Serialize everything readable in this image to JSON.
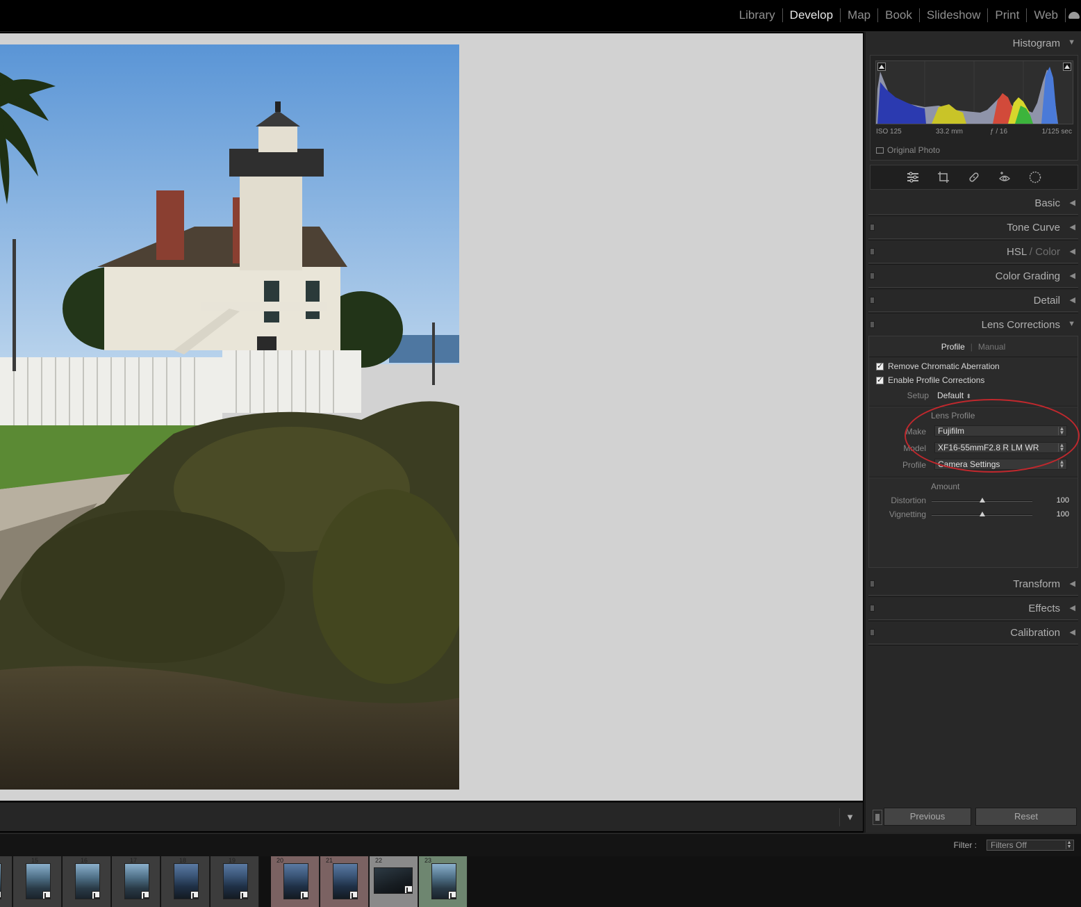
{
  "modules": [
    {
      "label": "Library",
      "active": false
    },
    {
      "label": "Develop",
      "active": true
    },
    {
      "label": "Map",
      "active": false
    },
    {
      "label": "Book",
      "active": false
    },
    {
      "label": "Slideshow",
      "active": false
    },
    {
      "label": "Print",
      "active": false
    },
    {
      "label": "Web",
      "active": false
    }
  ],
  "histogram": {
    "title": "Histogram",
    "iso": "ISO 125",
    "focal": "33.2 mm",
    "aperture": "ƒ / 16",
    "shutter": "1/125 sec",
    "original_photo": "Original Photo"
  },
  "tools": [
    "sliders-icon",
    "crop-icon",
    "healing-icon",
    "redeye-icon",
    "mask-icon"
  ],
  "panels": {
    "basic": "Basic",
    "tone_curve": "Tone Curve",
    "hsl": "HSL",
    "hsl_sep": "/",
    "hsl_color": "Color",
    "color_grading": "Color Grading",
    "detail": "Detail",
    "lens_corrections": "Lens Corrections",
    "transform": "Transform",
    "effects": "Effects",
    "calibration": "Calibration"
  },
  "lens": {
    "tab_profile": "Profile",
    "tab_manual": "Manual",
    "remove_ca": "Remove Chromatic Aberration",
    "enable_profile": "Enable Profile Corrections",
    "setup_label": "Setup",
    "setup_value": "Default",
    "lens_profile_heading": "Lens Profile",
    "make_label": "Make",
    "make_value": "Fujifilm",
    "model_label": "Model",
    "model_value": "XF16-55mmF2.8 R LM WR",
    "profile_label": "Profile",
    "profile_value": "Camera Settings",
    "amount_heading": "Amount",
    "distortion_label": "Distortion",
    "distortion_value": "100",
    "vignetting_label": "Vignetting",
    "vignetting_value": "100"
  },
  "footer": {
    "previous": "Previous",
    "reset": "Reset"
  },
  "filter": {
    "label": "Filter :",
    "value": "Filters Off"
  },
  "filmstrip": [
    {
      "num": "",
      "label": "none"
    },
    {
      "num": "15",
      "label": "none"
    },
    {
      "num": "16",
      "label": "none"
    },
    {
      "num": "17",
      "label": "none"
    },
    {
      "num": "18",
      "label": "none"
    },
    {
      "num": "19",
      "label": "none"
    },
    {
      "num": "20",
      "label": "red"
    },
    {
      "num": "21",
      "label": "red"
    },
    {
      "num": "22",
      "label": "gray"
    },
    {
      "num": "23",
      "label": "green"
    }
  ],
  "colors": {
    "accent_annotation": "#c0282d",
    "background": "#d2d2d2"
  }
}
